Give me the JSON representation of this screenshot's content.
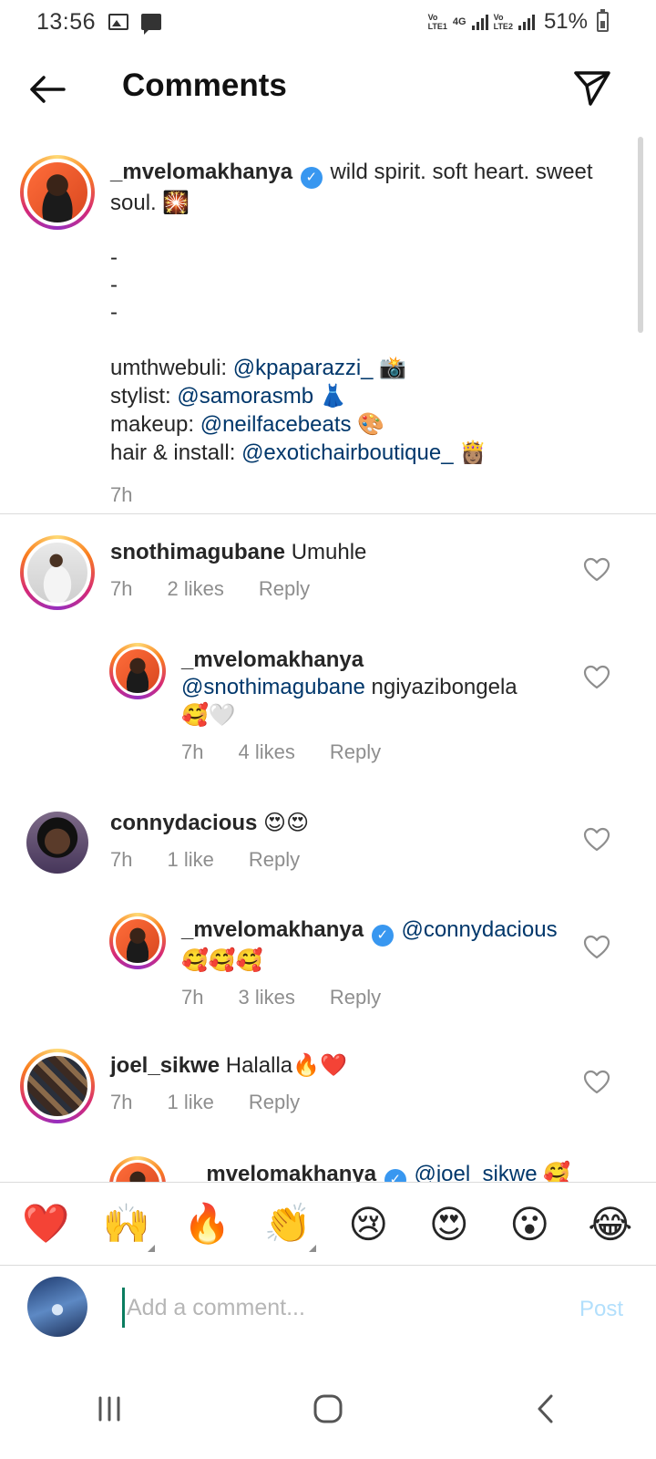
{
  "status_bar": {
    "time": "13:56",
    "net1_top": "Vo",
    "net1_bottom": "LTE1",
    "net_type": "4G",
    "net2_top": "Vo",
    "net2_bottom": "LTE2",
    "battery": "51%"
  },
  "header": {
    "title": "Comments"
  },
  "caption": {
    "username": "_mvelomakhanya",
    "text_line1": "wild spirit. soft heart.",
    "text_line2": "sweet soul.",
    "text_line2_emoji": "🎇",
    "dashes": "-\n-\n-",
    "credit1_label": "umthwebuli: ",
    "credit1_mention": "@kpaparazzi_",
    "credit1_emoji": "📸",
    "credit2_label": "stylist: ",
    "credit2_mention": "@samorasmb",
    "credit2_emoji": "👗",
    "credit3_label": "makeup: ",
    "credit3_mention": "@neilfacebeats",
    "credit3_emoji": "🎨",
    "credit4_label": "hair & install: ",
    "credit4_mention": "@exotichairboutique_",
    "credit4_emoji": "👸🏽",
    "time": "7h"
  },
  "comments": [
    {
      "username": "snothimagubane",
      "text": "Umuhle",
      "time": "7h",
      "likes": "2 likes",
      "reply": "Reply"
    },
    {
      "username": "_mvelomakhanya",
      "mention": "@snothimagubane",
      "text": " ngiyazibongela",
      "emoji": "🥰🤍",
      "time": "7h",
      "likes": "4 likes",
      "reply": "Reply"
    },
    {
      "username": "connydacious",
      "emoji": "😍😍",
      "time": "7h",
      "likes": "1 like",
      "reply": "Reply"
    },
    {
      "username": "_mvelomakhanya",
      "mention": "@connydacious",
      "emoji": "🥰🥰🥰",
      "time": "7h",
      "likes": "3 likes",
      "reply": "Reply"
    },
    {
      "username": "joel_sikwe",
      "text": "Halalla",
      "emoji": "🔥❤️",
      "time": "7h",
      "likes": "1 like",
      "reply": "Reply"
    },
    {
      "username": "_mvelomakhanya",
      "mention": "@joel_sikwe",
      "emoji": "🥰"
    }
  ],
  "quick_emojis": [
    "❤️",
    "🙌",
    "🔥",
    "👏",
    "😢",
    "😍",
    "😮",
    "😂"
  ],
  "composer": {
    "placeholder": "Add a comment...",
    "post_label": "Post"
  },
  "icons": {
    "back": "arrow-left-icon",
    "send": "paper-plane-icon",
    "like": "heart-outline-icon",
    "verified": "verified-badge-icon",
    "nav_recents": "recents-icon",
    "nav_home": "home-icon",
    "nav_back": "chevron-left-icon"
  }
}
